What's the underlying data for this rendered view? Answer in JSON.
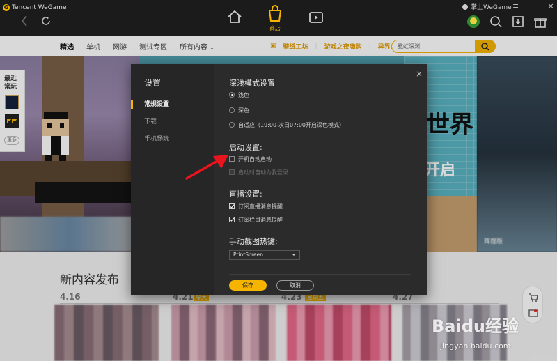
{
  "app": {
    "brand": "Tencent WeGame",
    "store_label": "商店",
    "user_label": "掌上WeGame"
  },
  "nav": {
    "tabs": [
      "精选",
      "单机",
      "网游",
      "测试专区",
      "所有内容"
    ],
    "active_tab": 0,
    "links": [
      "壁纸工坊",
      "游戏之夜嗨购",
      "异界之上"
    ],
    "search_value": "霓虹深渊"
  },
  "left_float": {
    "title_line1": "最近",
    "title_line2": "常玩",
    "more_label": "更多"
  },
  "banner": {
    "text_line1": "世界",
    "text_line2": "开启",
    "right_label": "辉煌版"
  },
  "lower": {
    "section_title": "新内容发布",
    "dates": [
      {
        "date": "4.16",
        "badge": ""
      },
      {
        "date": "4.21",
        "badge": "今天"
      },
      {
        "date": "4.23",
        "badge": "星期五"
      },
      {
        "date": "4.27",
        "badge": ""
      }
    ]
  },
  "dialog": {
    "title": "设置",
    "menu": [
      "常规设置",
      "下载",
      "手机畅玩"
    ],
    "active_menu": 0,
    "theme": {
      "title": "深浅模式设置",
      "options": [
        "浅色",
        "深色",
        "自适应（19:00-次日07:00开启深色模式）"
      ],
      "selected": 0
    },
    "startup": {
      "title": "启动设置:",
      "auto_start_label": "开机自动启动",
      "auto_start_checked": false,
      "auto_login_label": "启动时自动为我登录",
      "auto_login_disabled": true
    },
    "live": {
      "title": "直播设置:",
      "live_notify_label": "订阅直播消息提醒",
      "live_notify_checked": true,
      "column_notify_label": "订阅栏目消息提醒",
      "column_notify_checked": true
    },
    "hotkey": {
      "title": "手动截图热键:",
      "value": "PrintScreen"
    },
    "save_label": "保存",
    "cancel_label": "取消"
  },
  "watermark": {
    "logo": "Baidu经验",
    "url": "jingyan.baidu.com"
  },
  "colors": {
    "accent": "#f5b400",
    "topbar": "#1b1b1b",
    "dialog_bg": "#2b2b2b",
    "arrow": "#e8141e"
  }
}
